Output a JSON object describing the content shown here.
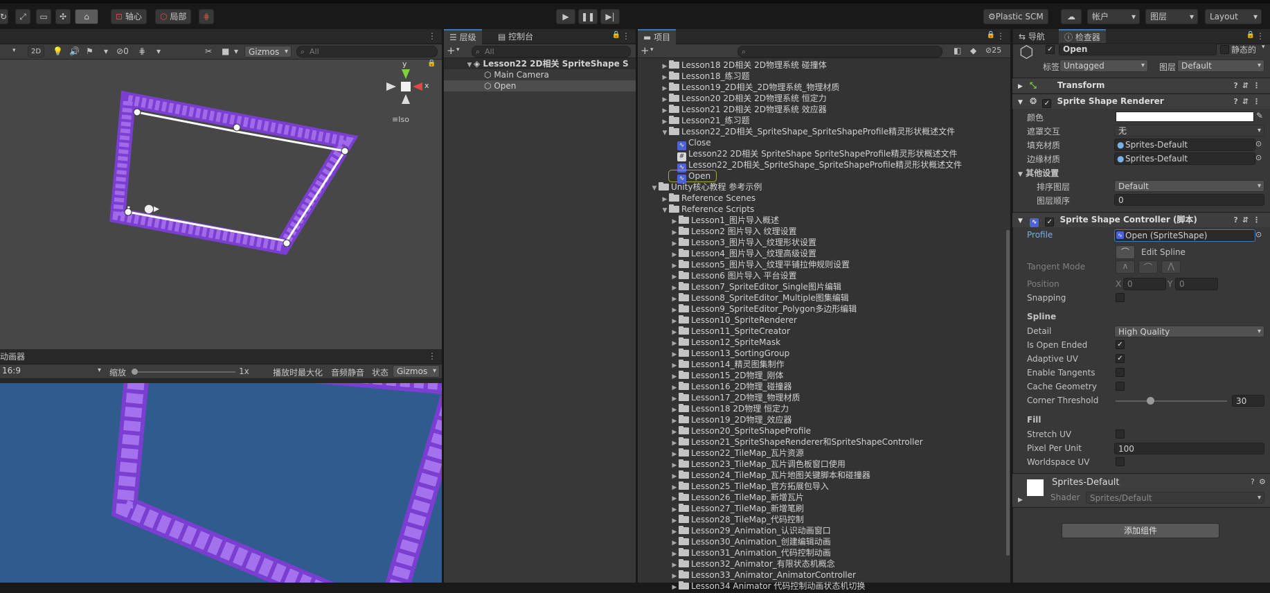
{
  "toolbar": {
    "pivot_label": "轴心",
    "local_label": "局部",
    "plastic_label": "Plastic SCM",
    "account_label": "帐户",
    "layers_label": "图层",
    "layout_label": "Layout"
  },
  "scene": {
    "mode_2d": "2D",
    "hidden_count": "0",
    "gizmos_label": "Gizmos",
    "search_placeholder": "All",
    "iso_label": "Iso",
    "axis_y": "y",
    "axis_x": "x",
    "spline_points": 5
  },
  "game": {
    "tab_label": "动画器",
    "aspect_label": "16:9",
    "scale_label": "缩放",
    "scale_value": "1x",
    "maximize_label": "播放时最大化",
    "mute_label": "音频静音",
    "stats_label": "状态",
    "gizmos_label": "Gizmos"
  },
  "hierarchy": {
    "tab_label": "层级",
    "console_label": "控制台",
    "search_placeholder": "All",
    "scene_name": "Lesson22 2D相关 SpriteShape S",
    "items": [
      "Main Camera",
      "Open"
    ]
  },
  "project": {
    "tab_label": "项目",
    "hidden_count": "25",
    "top_items": [
      "Lesson18 2D相关 2D物理系统 碰撞体",
      "Lesson18_练习题",
      "Lesson19_2D相关_2D物理系统_物理材质",
      "Lesson20 2D相关 2D物理系统 恒定力",
      "Lesson21 2D相关 2D物理系统 效应器",
      "Lesson21_练习题"
    ],
    "open_folder": "Lesson22_2D相关_SpriteShape_SpriteShapeProfile精灵形状概述文件",
    "sub_items": [
      "Close",
      "Lesson22 2D相关 SpriteShape SpriteShapeProfile精灵形状概述文件",
      "Lesson22_2D相关_SpriteShape_SpriteShapeProfile精灵形状概述文件",
      "Open"
    ],
    "root_folder": "Unity核心教程 参考示例",
    "ref_scenes": "Reference Scenes",
    "ref_scripts": "Reference Scripts",
    "scripts": [
      "Lesson1_图片导入概述",
      "Lesson2 图片导入 纹理设置",
      "Lesson3_图片导入_纹理形状设置",
      "Lesson4_图片导入_纹理高级设置",
      "Lesson5_图片导入_纹理平铺拉伸规则设置",
      "Lesson6 图片导入 平台设置",
      "Lesson7_SpriteEditor_Single图片编辑",
      "Lesson8_SpriteEditor_Multiple图集编辑",
      "Lesson9_SpriteEditor_Polygon多边形编辑",
      "Lesson10_SpriteRenderer",
      "Lesson11_SpriteCreator",
      "Lesson12_SpriteMask",
      "Lesson13_SortingGroup",
      "Lesson14_精灵图集制作",
      "Lesson15_2D物理_刚体",
      "Lesson16_2D物理_碰撞器",
      "Lesson17_2D物理_物理材质",
      "Lesson18 2D物理 恒定力",
      "Lesson19_2D物理_效应器",
      "Lesson20_SpriteShapeProfile",
      "Lesson21_SpriteShapeRenderer和SpriteShapeController",
      "Lesson22_TileMap_瓦片资源",
      "Lesson23_TileMap_瓦片调色板窗口使用",
      "Lesson24_TileMap_瓦片地图关键脚本和碰撞器",
      "Lesson25_TileMap_官方拓展包导入",
      "Lesson26_TileMap_新增瓦片",
      "Lesson27_TileMap_新增笔刷",
      "Lesson28_TileMap_代码控制",
      "Lesson29_Animation_认识动画窗口",
      "Lesson30_Animation_创建编辑动画",
      "Lesson31_Animation_代码控制动画",
      "Lesson32_Animator_有限状态机概念",
      "Lesson33_Animator_AnimatorController",
      "Lesson34 Animator 代码控制动画状态机切换"
    ]
  },
  "inspector": {
    "nav_tab": "导航",
    "inspector_tab": "检查器",
    "object_name": "Open",
    "static_label": "静态的",
    "tag_label": "标签",
    "tag_value": "Untagged",
    "layer_label": "图层",
    "layer_value": "Default",
    "transform_label": "Transform",
    "ssr_label": "Sprite Shape Renderer",
    "color_label": "颜色",
    "mask_label": "遮罩交互",
    "mask_value": "无",
    "fill_mat_label": "填充材质",
    "fill_mat_value": "Sprites-Default",
    "edge_mat_label": "边缘材质",
    "edge_mat_value": "Sprites-Default",
    "other_label": "其他设置",
    "sorting_layer_label": "排序图层",
    "sorting_layer_value": "Default",
    "order_label": "图层顺序",
    "order_value": "0",
    "ssc_label": "Sprite Shape Controller (脚本)",
    "profile_label": "Profile",
    "profile_value": "Open (SpriteShape)",
    "edit_spline_label": "Edit Spline",
    "tangent_label": "Tangent Mode",
    "position_label": "Position",
    "pos_x_label": "X",
    "pos_x_value": "0",
    "pos_y_label": "Y",
    "pos_y_value": "0",
    "snapping_label": "Snapping",
    "spline_header": "Spline",
    "detail_label": "Detail",
    "detail_value": "High Quality",
    "open_ended_label": "Is Open Ended",
    "adaptive_label": "Adaptive UV",
    "tangents_label": "Enable Tangents",
    "cache_label": "Cache Geometry",
    "corner_label": "Corner Threshold",
    "corner_value": "30",
    "corner_fraction": 0.3,
    "fill_header": "Fill",
    "stretch_label": "Stretch UV",
    "ppu_label": "Pixel Per Unit",
    "ppu_value": "100",
    "worldspace_label": "Worldspace UV",
    "material_name": "Sprites-Default",
    "shader_label": "Shader",
    "shader_value": "Sprites/Default",
    "add_component_label": "添加组件"
  }
}
